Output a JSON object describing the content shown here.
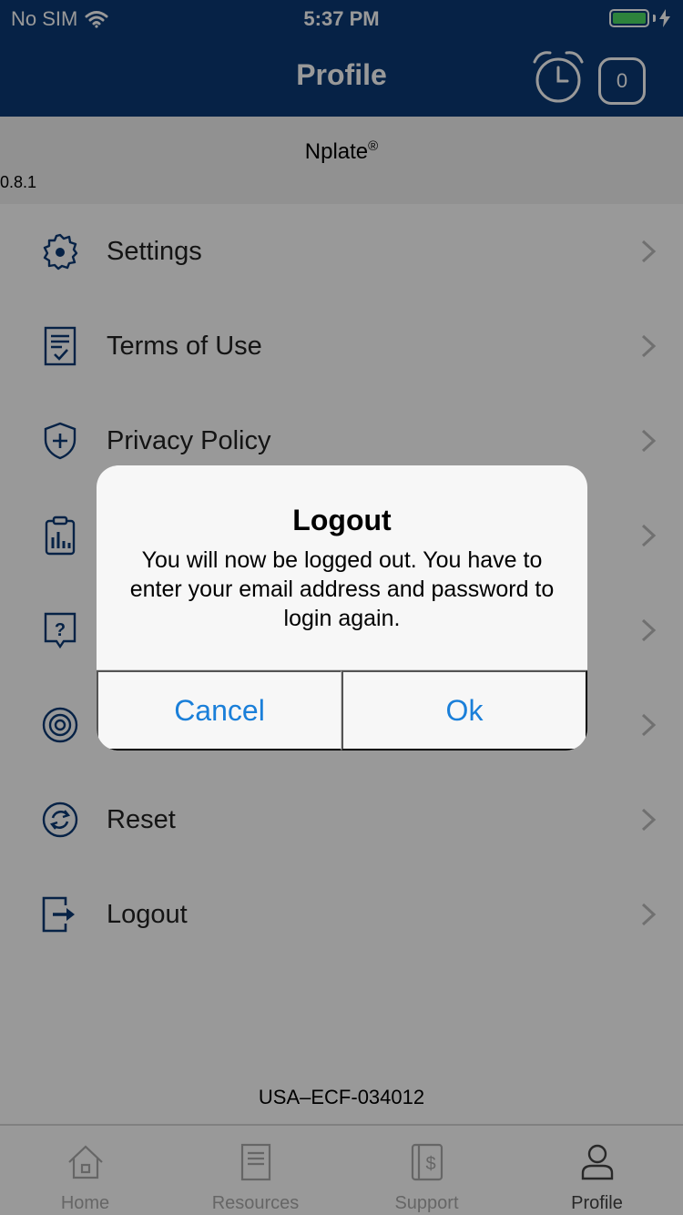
{
  "status_bar": {
    "carrier": "No SIM",
    "time": "5:37 PM"
  },
  "nav_bar": {
    "title": "Profile",
    "badge_count": "0"
  },
  "app_info": {
    "name": "Nplate",
    "trademark": "®",
    "version": "0.8.1"
  },
  "menu": {
    "items": [
      {
        "label": "Settings",
        "icon": "gear-icon"
      },
      {
        "label": "Terms of Use",
        "icon": "document-check-icon"
      },
      {
        "label": "Privacy Policy",
        "icon": "shield-plus-icon"
      },
      {
        "label": "",
        "icon": "clipboard-chart-icon"
      },
      {
        "label": "",
        "icon": "question-shield-icon"
      },
      {
        "label": "",
        "icon": "lifebuoy-icon"
      },
      {
        "label": "Reset",
        "icon": "refresh-icon"
      },
      {
        "label": "Logout",
        "icon": "logout-icon"
      }
    ]
  },
  "footer": {
    "code": "USA–ECF-034012"
  },
  "tab_bar": {
    "tabs": [
      {
        "label": "Home",
        "icon": "home-icon"
      },
      {
        "label": "Resources",
        "icon": "document-icon"
      },
      {
        "label": "Support",
        "icon": "dollar-document-icon"
      },
      {
        "label": "Profile",
        "icon": "user-icon",
        "active": true
      }
    ]
  },
  "dialog": {
    "title": "Logout",
    "message": "You will now be logged out. You have to enter your email address and password to login again.",
    "cancel_label": "Cancel",
    "ok_label": "Ok"
  },
  "colors": {
    "brand": "#0b3a75",
    "icon": "#0b3a75",
    "link": "#1a7fd9",
    "battery": "#4cd964"
  }
}
